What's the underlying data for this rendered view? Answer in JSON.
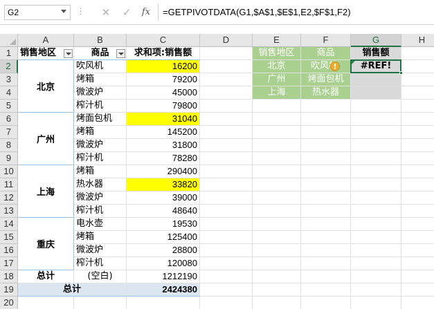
{
  "formula_bar": {
    "name_box": "G2",
    "cancel_icon": "✕",
    "confirm_icon": "✓",
    "fx_label": "fx",
    "formula": "=GETPIVOTDATA(G1,$A$1,$E$1,E2,$F$1,F2)"
  },
  "columns": [
    "A",
    "B",
    "C",
    "D",
    "E",
    "F",
    "G",
    "H"
  ],
  "rows": [
    "1",
    "2",
    "3",
    "4",
    "5",
    "6",
    "7",
    "8",
    "9",
    "10",
    "11",
    "12",
    "13",
    "14",
    "15",
    "16",
    "17",
    "18",
    "19",
    "20"
  ],
  "pivot": {
    "header_region": "销售地区",
    "header_product": "商品",
    "header_sum": "求和项:销售额",
    "regions": [
      "北京",
      "广州",
      "上海",
      "重庆"
    ],
    "rows": [
      {
        "product": "吹风机",
        "value": "16200"
      },
      {
        "product": "烤箱",
        "value": "79200"
      },
      {
        "product": "微波炉",
        "value": "45000"
      },
      {
        "product": "榨汁机",
        "value": "79800"
      },
      {
        "product": "烤面包机",
        "value": "31040"
      },
      {
        "product": "烤箱",
        "value": "145200"
      },
      {
        "product": "微波炉",
        "value": "31800"
      },
      {
        "product": "榨汁机",
        "value": "78280"
      },
      {
        "product": "烤箱",
        "value": "290400"
      },
      {
        "product": "热水器",
        "value": "33820"
      },
      {
        "product": "微波炉",
        "value": "39000"
      },
      {
        "product": "榨汁机",
        "value": "48640"
      },
      {
        "product": "电水壶",
        "value": "19530"
      },
      {
        "product": "烤箱",
        "value": "125400"
      },
      {
        "product": "微波炉",
        "value": "28800"
      },
      {
        "product": "榨汁机",
        "value": "120080"
      }
    ],
    "total_label": "总计",
    "blank_label": "(空白)",
    "blank_value": "1212190",
    "grand_total_label": "总计",
    "grand_total_value": "2424380"
  },
  "lookup": {
    "h_region": "销售地区",
    "h_product": "商品",
    "h_sales": "销售额",
    "rows": [
      {
        "region": "北京",
        "product": "吹风机",
        "result": "#REF!"
      },
      {
        "region": "广州",
        "product": "烤面包机",
        "result": ""
      },
      {
        "region": "上海",
        "product": "热水器",
        "result": ""
      }
    ],
    "warning_icon": "!"
  },
  "colors": {
    "highlight": "#ffff00",
    "lookup_header": "#a9d08e",
    "selection": "#217346",
    "total_row": "#dce6f1"
  }
}
